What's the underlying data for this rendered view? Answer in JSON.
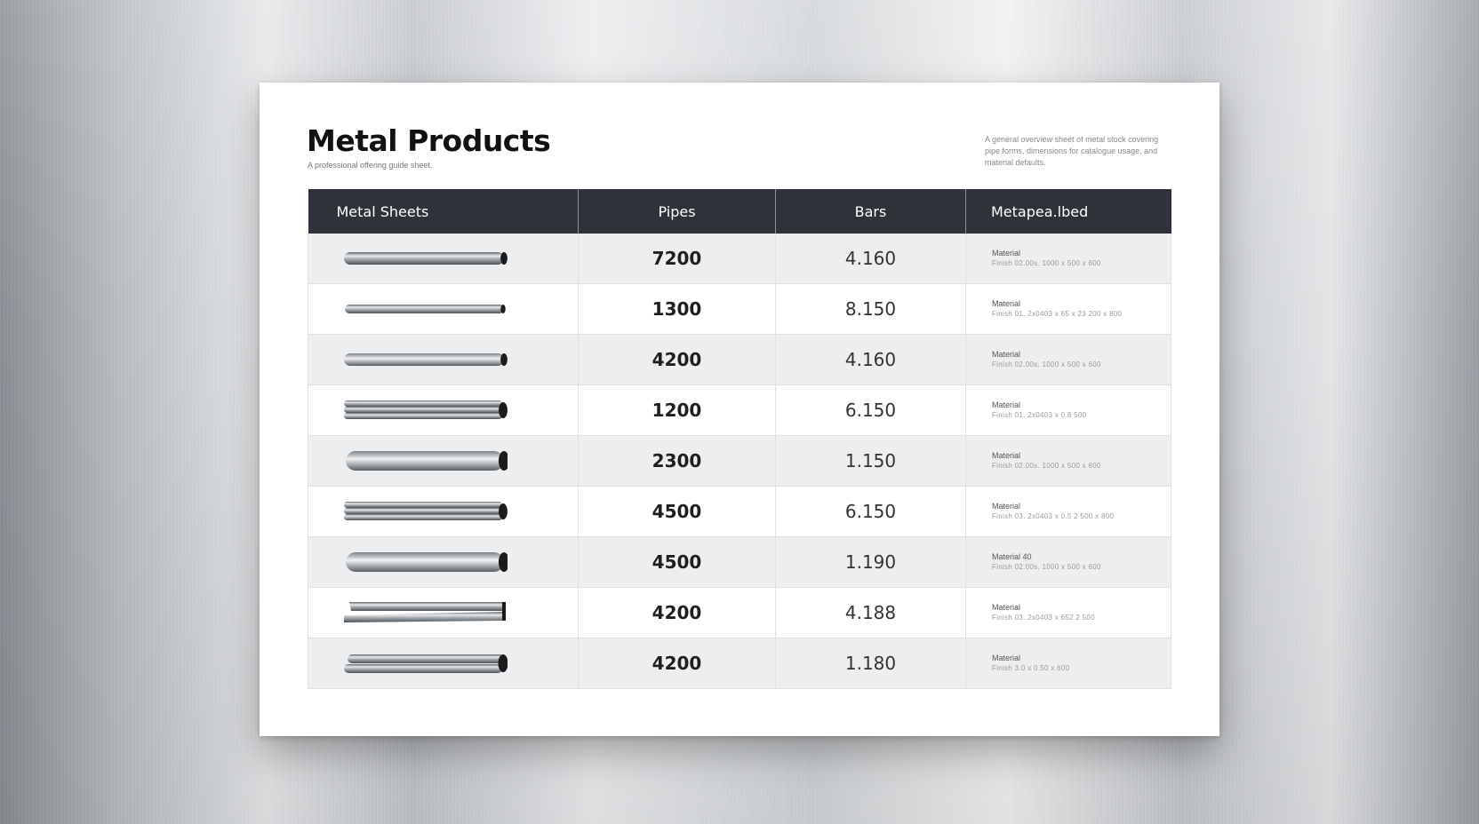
{
  "page": {
    "title": "Metal Products",
    "subtitle": "A professional offering guide sheet.",
    "description": "A general overview sheet of metal stock covering pipe forms, dimensions for catalogue usage, and material defaults."
  },
  "table": {
    "headers": [
      "Metal Sheets",
      "Pipes",
      "Bars",
      "Metapea.lbed"
    ],
    "rows": [
      {
        "image_icon": "round-pipe-icon",
        "pipes": "7200",
        "bars": "4.160",
        "material_label": "Material",
        "material_detail": "Finish 02.00s. 1000 x 500 x 600"
      },
      {
        "image_icon": "thin-rod-icon",
        "pipes": "1300",
        "bars": "8.150",
        "material_label": "Material",
        "material_detail": "Finish 01. 2x0403 x 65 x 23 200 x 800"
      },
      {
        "image_icon": "round-bar-icon",
        "pipes": "4200",
        "bars": "4.160",
        "material_label": "Material",
        "material_detail": "Finish 02.00s. 1000 x 500 x 600"
      },
      {
        "image_icon": "bar-bundle-icon",
        "pipes": "1200",
        "bars": "6.150",
        "material_label": "Material",
        "material_detail": "Finish 01. 2x0403 x 0.8 500"
      },
      {
        "image_icon": "tube-icon",
        "pipes": "2300",
        "bars": "1.150",
        "material_label": "Material",
        "material_detail": "Finish 02.00s. 1000 x 500 x 600"
      },
      {
        "image_icon": "bar-bundle-icon",
        "pipes": "4500",
        "bars": "6.150",
        "material_label": "Material",
        "material_detail": "Finish 03. 2x0403 x 0.5 2 500 x 800"
      },
      {
        "image_icon": "tube-icon",
        "pipes": "4500",
        "bars": "1.190",
        "material_label": "Material 40",
        "material_detail": "Finish 02.00s. 1000 x 500 x 600"
      },
      {
        "image_icon": "angle-profile-icon",
        "pipes": "4200",
        "bars": "4.188",
        "material_label": "Material",
        "material_detail": "Finish 03. 2x0403 x 652 2 500"
      },
      {
        "image_icon": "pipe-pair-icon",
        "pipes": "4200",
        "bars": "1.180",
        "material_label": "Material",
        "material_detail": "Finish 3.0 x 0.50 x 600"
      }
    ]
  },
  "colors": {
    "header_bg": "#2d3338",
    "row_alt": "#eceef0",
    "metal_dark": "#6f757b",
    "metal_light": "#e9ebed"
  }
}
